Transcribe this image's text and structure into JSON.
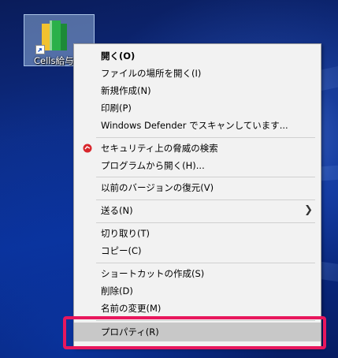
{
  "desktop": {
    "icon": {
      "label": "Cells給与",
      "icon_name": "book-shortcut-icon"
    }
  },
  "context_menu": {
    "items": [
      {
        "label": "開く(O)",
        "bold": true
      },
      {
        "label": "ファイルの場所を開く(I)"
      },
      {
        "label": "新規作成(N)"
      },
      {
        "label": "印刷(P)"
      },
      {
        "label": "Windows Defender でスキャンしています..."
      },
      {
        "label": "セキュリティ上の脅威の検索",
        "icon": "security-scan-icon"
      },
      {
        "label": "プログラムから開く(H)..."
      },
      {
        "label": "以前のバージョンの復元(V)"
      },
      {
        "label": "送る(N)",
        "submenu": true
      },
      {
        "label": "切り取り(T)"
      },
      {
        "label": "コピー(C)"
      },
      {
        "label": "ショートカットの作成(S)"
      },
      {
        "label": "削除(D)"
      },
      {
        "label": "名前の変更(M)"
      },
      {
        "label": "プロパティ(R)",
        "highlighted": true
      }
    ]
  },
  "colors": {
    "highlight_border": "#e8175d",
    "menu_background": "#f2f2f2",
    "hover_background": "#c8c8c8"
  }
}
